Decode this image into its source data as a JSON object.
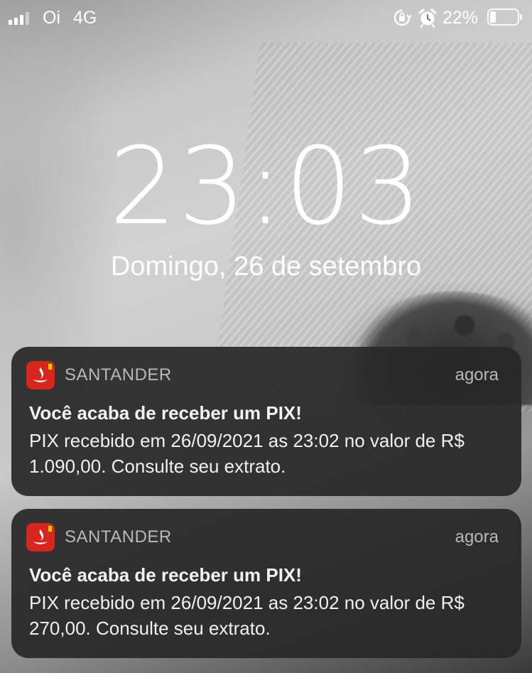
{
  "status_bar": {
    "carrier": "Oi",
    "network": "4G",
    "battery_percent": "22%",
    "battery_level": 0.22,
    "signal_bars": 4,
    "icons": [
      "signal-icon",
      "orientation-lock-icon",
      "alarm-icon",
      "battery-icon"
    ]
  },
  "lock_screen": {
    "time": "23:03",
    "date": "Domingo, 26 de setembro"
  },
  "notifications": [
    {
      "app": "SANTANDER",
      "time": "agora",
      "title": "Você acaba de receber um PIX!",
      "body": "PIX recebido em 26/09/2021 as 23:02 no valor de R$ 1.090,00. Consulte seu extrato.",
      "icon": "santander-flame-icon"
    },
    {
      "app": "SANTANDER",
      "time": "agora",
      "title": "Você acaba de receber um PIX!",
      "body": "PIX recebido em 26/09/2021 as 23:02 no valor de R$ 270,00. Consulte seu extrato.",
      "icon": "santander-flame-icon"
    }
  ],
  "colors": {
    "santander_red": "#d7261e",
    "notification_bg": "#282828"
  }
}
